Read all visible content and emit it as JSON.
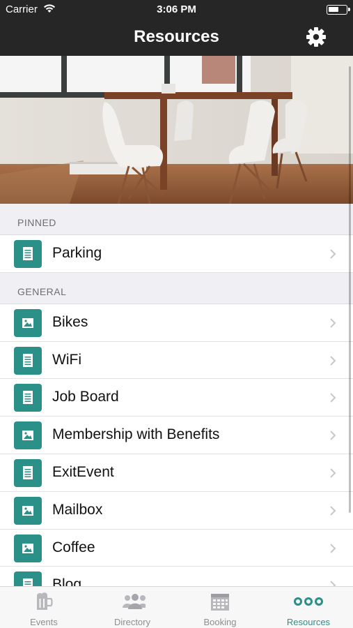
{
  "status_bar": {
    "carrier": "Carrier",
    "time": "3:06 PM"
  },
  "nav": {
    "title": "Resources",
    "settings_icon": "gear-icon"
  },
  "colors": {
    "accent": "#2b9088",
    "nav_bg": "#262626",
    "section_bg": "#efeff4"
  },
  "sections": [
    {
      "title": "PINNED",
      "items": [
        {
          "label": "Parking",
          "icon": "document-icon"
        }
      ]
    },
    {
      "title": "GENERAL",
      "items": [
        {
          "label": "Bikes",
          "icon": "image-icon"
        },
        {
          "label": "WiFi",
          "icon": "document-icon"
        },
        {
          "label": "Job Board",
          "icon": "document-icon"
        },
        {
          "label": "Membership with Benefits",
          "icon": "image-icon"
        },
        {
          "label": "ExitEvent",
          "icon": "document-icon"
        },
        {
          "label": "Mailbox",
          "icon": "image-icon"
        },
        {
          "label": "Coffee",
          "icon": "image-icon"
        },
        {
          "label": "Blog",
          "icon": "document-icon"
        }
      ]
    }
  ],
  "tabs": [
    {
      "label": "Events",
      "icon": "beer-mug-icon",
      "active": false
    },
    {
      "label": "Directory",
      "icon": "people-icon",
      "active": false
    },
    {
      "label": "Booking",
      "icon": "calendar-icon",
      "active": false
    },
    {
      "label": "Resources",
      "icon": "more-dots-icon",
      "active": true
    }
  ]
}
